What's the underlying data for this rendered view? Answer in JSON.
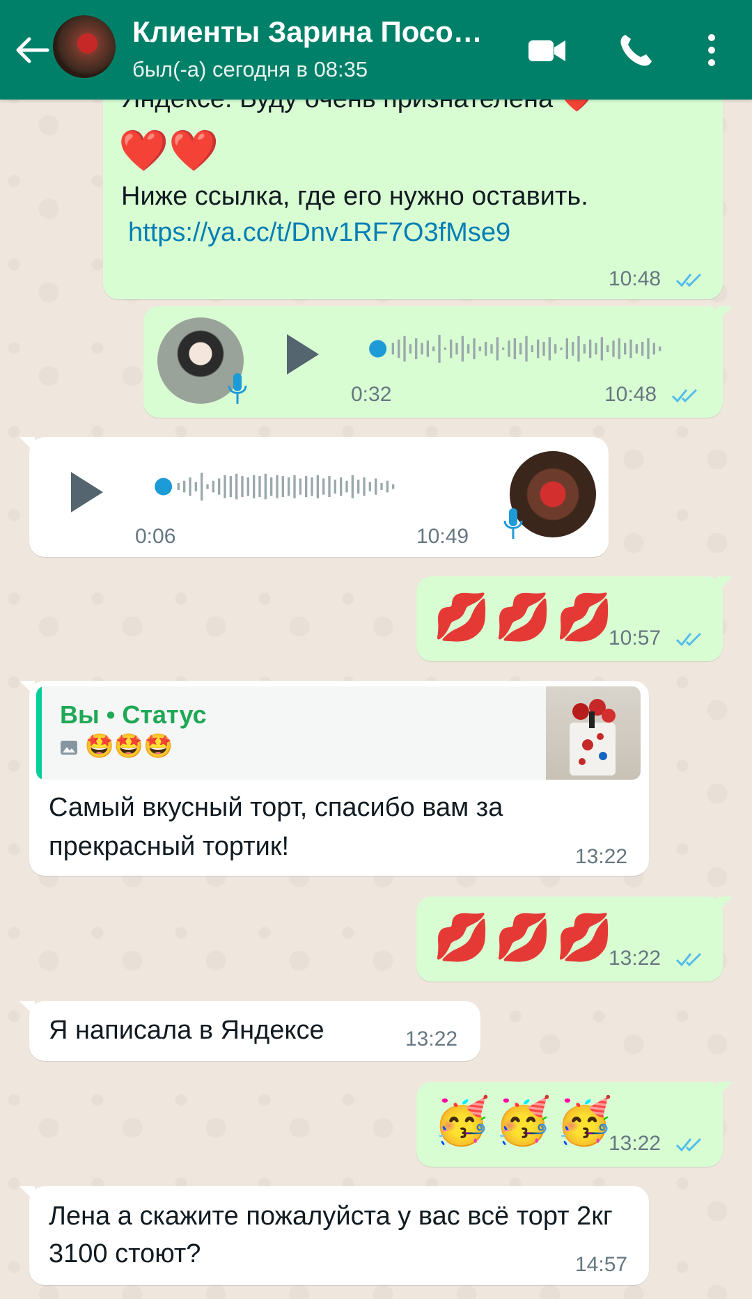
{
  "header": {
    "title": "Клиенты Зарина Посо…",
    "status": "был(-а) сегодня в 08:35",
    "icons": [
      "back-arrow-icon",
      "video-call-icon",
      "phone-icon",
      "more-vert-icon"
    ]
  },
  "messages": {
    "m1": {
      "line_top": "Яндексе. Буду очень признателена ❤️",
      "hearts": "❤️❤️",
      "line2": "Ниже ссылка, где его нужно оставить.",
      "link": "https://ya.cc/t/Dnv1RF7O3fMse9",
      "time": "10:48"
    },
    "m2": {
      "duration": "0:32",
      "time": "10:48"
    },
    "m3": {
      "duration": "0:06",
      "time": "10:49"
    },
    "m4": {
      "emoji": "💋💋💋",
      "time": "10:57"
    },
    "m5": {
      "quote_name": "Вы • Статус",
      "quote_emoji": "🤩🤩🤩",
      "text": "Самый вкусный торт, спасибо вам за прекрасный тортик!",
      "time": "13:22"
    },
    "m6": {
      "emoji": "💋💋💋",
      "time": "13:22"
    },
    "m7": {
      "text": "Я написала в Яндексе",
      "time": "13:22"
    },
    "m8": {
      "emoji": "🥳🥳🥳",
      "time": "13:22"
    },
    "m9": {
      "text": "Лена а скажите пожалуйста у вас всё торт 2кг 3100 стоют?",
      "time": "14:57"
    }
  },
  "colors": {
    "header": "#008069",
    "outgoing_bubble": "#D9FDD3",
    "incoming_bubble": "#FFFFFF",
    "read_ticks": "#53bdeb",
    "link": "#027eb5",
    "voice_dot": "#1d9bd7"
  }
}
